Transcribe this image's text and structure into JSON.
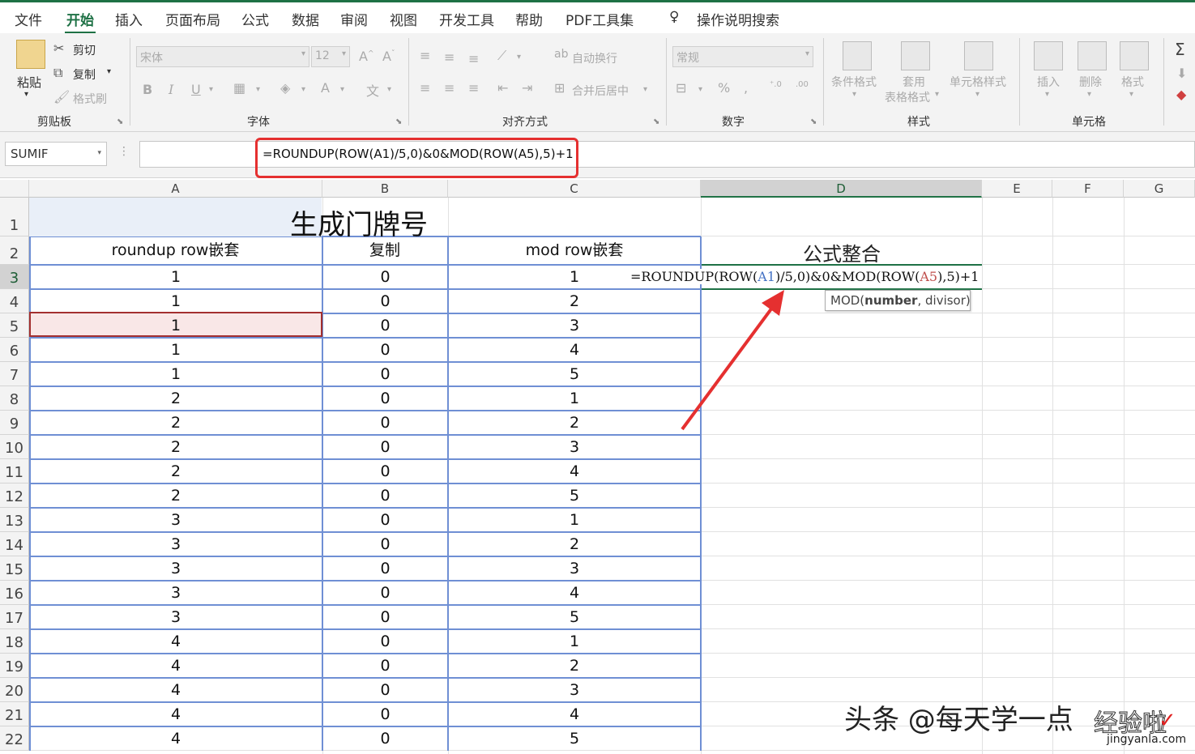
{
  "menu": {
    "items": [
      "文件",
      "开始",
      "插入",
      "页面布局",
      "公式",
      "数据",
      "审阅",
      "视图",
      "开发工具",
      "帮助",
      "PDF工具集"
    ],
    "active_index": 1,
    "tell_me": "操作说明搜索"
  },
  "ribbon": {
    "clipboard": {
      "paste": "粘贴",
      "cut": "剪切",
      "copy": "复制",
      "format_painter": "格式刷",
      "label": "剪贴板"
    },
    "font": {
      "name": "宋体",
      "size": "12",
      "label": "字体",
      "bold": "B",
      "italic": "I",
      "underline": "U"
    },
    "alignment": {
      "wrap": "自动换行",
      "merge": "合并后居中",
      "label": "对齐方式"
    },
    "number": {
      "format": "常规",
      "label": "数字"
    },
    "styles": {
      "conditional": "条件格式",
      "table_format_1": "套用",
      "table_format_2": "表格格式",
      "cell_styles": "单元格样式",
      "label": "样式"
    },
    "cells": {
      "insert": "插入",
      "delete": "删除",
      "format": "格式",
      "label": "单元格"
    }
  },
  "formula_bar": {
    "name_box": "SUMIF",
    "formula": "=ROUNDUP(ROW(A1)/5,0)&0&MOD(ROW(A5),5)+1"
  },
  "columns": [
    "A",
    "B",
    "C",
    "D",
    "E",
    "F",
    "G"
  ],
  "selected_column": "D",
  "selected_row": 3,
  "sheet": {
    "title": "生成门牌号",
    "headers": {
      "a": "roundup  row嵌套",
      "b": "复制",
      "c": "mod  row嵌套",
      "d": "公式整合"
    },
    "rows": [
      {
        "r": 3,
        "a": "1",
        "b": "0",
        "c": "1"
      },
      {
        "r": 4,
        "a": "1",
        "b": "0",
        "c": "2"
      },
      {
        "r": 5,
        "a": "1",
        "b": "0",
        "c": "3"
      },
      {
        "r": 6,
        "a": "1",
        "b": "0",
        "c": "4"
      },
      {
        "r": 7,
        "a": "1",
        "b": "0",
        "c": "5"
      },
      {
        "r": 8,
        "a": "2",
        "b": "0",
        "c": "1"
      },
      {
        "r": 9,
        "a": "2",
        "b": "0",
        "c": "2"
      },
      {
        "r": 10,
        "a": "2",
        "b": "0",
        "c": "3"
      },
      {
        "r": 11,
        "a": "2",
        "b": "0",
        "c": "4"
      },
      {
        "r": 12,
        "a": "2",
        "b": "0",
        "c": "5"
      },
      {
        "r": 13,
        "a": "3",
        "b": "0",
        "c": "1"
      },
      {
        "r": 14,
        "a": "3",
        "b": "0",
        "c": "2"
      },
      {
        "r": 15,
        "a": "3",
        "b": "0",
        "c": "3"
      },
      {
        "r": 16,
        "a": "3",
        "b": "0",
        "c": "4"
      },
      {
        "r": 17,
        "a": "3",
        "b": "0",
        "c": "5"
      },
      {
        "r": 18,
        "a": "4",
        "b": "0",
        "c": "1"
      },
      {
        "r": 19,
        "a": "4",
        "b": "0",
        "c": "2"
      },
      {
        "r": 20,
        "a": "4",
        "b": "0",
        "c": "3"
      },
      {
        "r": 21,
        "a": "4",
        "b": "0",
        "c": "4"
      },
      {
        "r": 22,
        "a": "4",
        "b": "0",
        "c": "5"
      }
    ],
    "d3_edit": {
      "p1": "=ROUNDUP(ROW(",
      "ref1": "A1",
      "p2": ")/5,0)&0&MOD(ROW(",
      "ref2": "A5",
      "p3": "),5)+1"
    },
    "tooltip": {
      "fn": "MOD(",
      "arg1": "number",
      ", ": ", ",
      "arg2": "divisor)"
    }
  },
  "watermark": {
    "text": "头条 @每天学一点",
    "brand": "经验啦",
    "site": "jingyanla.com"
  },
  "colors": {
    "accent": "#1e7145",
    "annotation": "#e53030",
    "selection_border": "#a32f2f"
  }
}
